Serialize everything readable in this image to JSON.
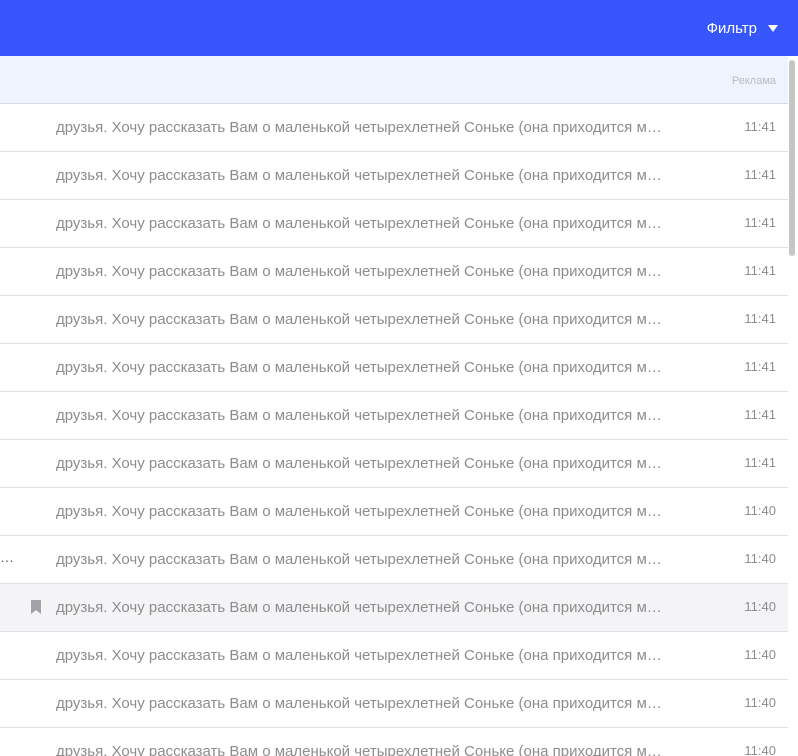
{
  "header": {
    "filter_label": "Фильтр",
    "accent_color": "#3656fb"
  },
  "ad_row": {
    "label": "Реклама"
  },
  "messages": [
    {
      "snippet": "друзья. Хочу рассказать Вам о маленькой четырехлетней Соньке (она приходится мне племянницей)",
      "time": "11:41"
    },
    {
      "snippet": "друзья. Хочу рассказать Вам о маленькой четырехлетней Соньке (она приходится мне племянницей)",
      "time": "11:41"
    },
    {
      "snippet": "друзья. Хочу рассказать Вам о маленькой четырехлетней Соньке (она приходится мне племянницей)",
      "time": "11:41"
    },
    {
      "snippet": "друзья. Хочу рассказать Вам о маленькой четырехлетней Соньке (она приходится мне племянницей)",
      "time": "11:41"
    },
    {
      "snippet": "друзья. Хочу рассказать Вам о маленькой четырехлетней Соньке (она приходится мне племянницей)",
      "time": "11:41"
    },
    {
      "snippet": "друзья. Хочу рассказать Вам о маленькой четырехлетней Соньке (она приходится мне племянницей)",
      "time": "11:41"
    },
    {
      "snippet": "друзья. Хочу рассказать Вам о маленькой четырехлетней Соньке (она приходится мне племянницей)",
      "time": "11:41"
    },
    {
      "snippet": "друзья. Хочу рассказать Вам о маленькой четырехлетней Соньке (она приходится мне племянницей)",
      "time": "11:41"
    },
    {
      "snippet": "друзья. Хочу рассказать Вам о маленькой четырехлетней Соньке (она приходится мне племянницей)",
      "time": "11:40"
    },
    {
      "snippet": "друзья. Хочу рассказать Вам о маленькой четырехлетней Соньке (она приходится мне племянницей)",
      "time": "11:40",
      "lead": "…"
    },
    {
      "snippet": "друзья. Хочу рассказать Вам о маленькой четырехлетней Соньке (она приходится мне племянницей)",
      "time": "11:40",
      "bookmark_icon": "bookmark-icon",
      "hovered": true
    },
    {
      "snippet": "друзья. Хочу рассказать Вам о маленькой четырехлетней Соньке (она приходится мне племянницей)",
      "time": "11:40"
    },
    {
      "snippet": "друзья. Хочу рассказать Вам о маленькой четырехлетней Соньке (она приходится мне племянницей)",
      "time": "11:40"
    },
    {
      "snippet": "друзья. Хочу рассказать Вам о маленькой четырехлетней Соньке (она приходится мне племянницей)",
      "time": "11:40"
    }
  ]
}
